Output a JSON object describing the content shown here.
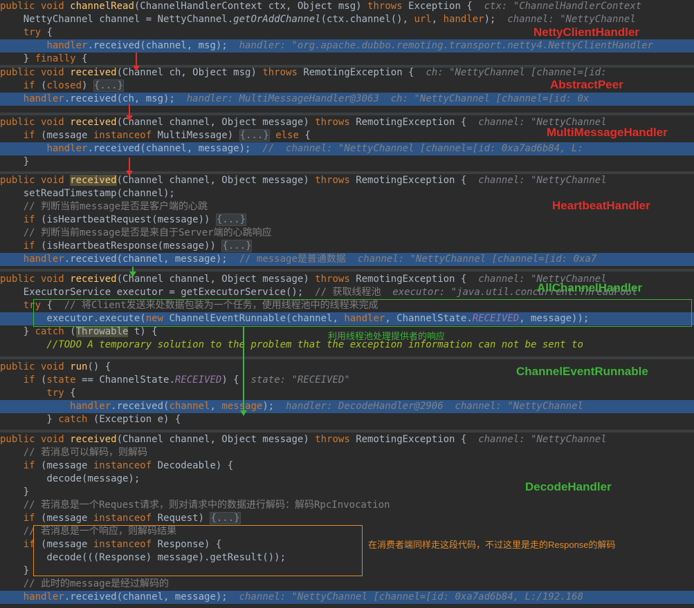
{
  "labels": {
    "netty": "NettyClientHandler",
    "abstract_peer": "AbstractPeer",
    "multi": "MultiMessageHandler",
    "heartbeat": "HeartbeatHandler",
    "all_channel": "AllChannelHandler",
    "runnable": "ChannelEventRunnable",
    "decode": "DecodeHandler"
  },
  "notes": {
    "thread_pool": "利用线程池处理提供者的响应",
    "consumer": "在消费者端同样走这段代码，不过这里是走的Response的解码"
  },
  "colors": {
    "background": "#2b2b2b",
    "highlight": "#2d5485",
    "keyword": "#cc7832",
    "method": "#ffc66d",
    "red_label": "#e0302b",
    "green_label": "#3fb33a",
    "orange_box": "#e08a2b"
  },
  "code": {
    "netty": [
      {
        "hl": false,
        "segs": [
          [
            "kw",
            "public void "
          ],
          [
            "fn",
            "channelRead"
          ],
          [
            "",
            "(ChannelHandlerContext ctx, Object msg) "
          ],
          [
            "kw",
            "throws "
          ],
          [
            "",
            "Exception {  "
          ],
          [
            "hint",
            "ctx: \"ChannelHandlerContext"
          ]
        ]
      },
      {
        "hl": false,
        "segs": [
          [
            "",
            "    NettyChannel channel = NettyChannel."
          ],
          [
            "it",
            "getOrAddChannel"
          ],
          [
            "",
            "(ctx.channel(), "
          ],
          [
            "kw",
            "url"
          ],
          [
            "",
            ", "
          ],
          [
            "kw",
            "handler"
          ],
          [
            "",
            ");  "
          ],
          [
            "hint",
            "channel: \"NettyChannel"
          ]
        ]
      },
      {
        "hl": false,
        "segs": [
          [
            "kw",
            "    try "
          ],
          [
            "",
            "{"
          ]
        ]
      },
      {
        "hl": true,
        "segs": [
          [
            "",
            "        "
          ],
          [
            "kw",
            "handler"
          ],
          [
            "",
            ".received(channel, msg);  "
          ],
          [
            "hint",
            "handler: \"org.apache.dubbo.remoting.transport.netty4.NettyClientHandler"
          ]
        ]
      },
      {
        "hl": false,
        "segs": [
          [
            "",
            "    } "
          ],
          [
            "kw",
            "finally "
          ],
          [
            "",
            "{"
          ]
        ]
      }
    ],
    "abstract_peer": [
      {
        "hl": false,
        "segs": [
          [
            "kw",
            "public void "
          ],
          [
            "fn",
            "received"
          ],
          [
            "",
            "(Channel ch, Object msg) "
          ],
          [
            "kw",
            "throws "
          ],
          [
            "",
            "RemotingException {  "
          ],
          [
            "hint",
            "ch: \"NettyChannel [channel=[id:"
          ]
        ]
      },
      {
        "hl": false,
        "segs": [
          [
            "kw",
            "    if "
          ],
          [
            "",
            "("
          ],
          [
            "kw",
            "closed"
          ],
          [
            "",
            ") "
          ],
          [
            "fold",
            "{...}"
          ]
        ]
      },
      {
        "hl": true,
        "segs": [
          [
            "",
            "    "
          ],
          [
            "kw",
            "handler"
          ],
          [
            "",
            ".received(ch, msg);  "
          ],
          [
            "hint",
            "handler: MultiMessageHandler@3063  ch: \"NettyChannel [channel=[id: 0x"
          ]
        ]
      }
    ],
    "multi": [
      {
        "hl": false,
        "segs": [
          [
            "kw",
            "public void "
          ],
          [
            "fn",
            "received"
          ],
          [
            "",
            "(Channel channel, Object message) "
          ],
          [
            "kw",
            "throws "
          ],
          [
            "",
            "RemotingException {  "
          ],
          [
            "hint",
            "channel: \"NettyChannel"
          ]
        ]
      },
      {
        "hl": false,
        "segs": [
          [
            "kw",
            "    if "
          ],
          [
            "",
            "(message "
          ],
          [
            "kw",
            "instanceof "
          ],
          [
            "",
            "MultiMessage) "
          ],
          [
            "fold",
            "{...}"
          ],
          [
            "",
            " "
          ],
          [
            "kw",
            "else "
          ],
          [
            "",
            "{"
          ]
        ]
      },
      {
        "hl": true,
        "segs": [
          [
            "",
            "        "
          ],
          [
            "kw",
            "handler"
          ],
          [
            "",
            ".received(channel, message);  "
          ],
          [
            "hint",
            "//  channel: \"NettyChannel [channel=[id: 0xa7ad6b84, L:"
          ]
        ]
      },
      {
        "hl": false,
        "segs": [
          [
            "",
            "    }"
          ]
        ]
      }
    ],
    "heartbeat": [
      {
        "hl": false,
        "segs": [
          [
            "kw",
            "public void "
          ],
          [
            "fnm",
            "received"
          ],
          [
            "",
            "(Channel channel, Object message) "
          ],
          [
            "kw",
            "throws "
          ],
          [
            "",
            "RemotingException {  "
          ],
          [
            "hint",
            "channel: \"NettyChannel"
          ]
        ]
      },
      {
        "hl": false,
        "segs": [
          [
            "",
            "    setReadTimestamp(channel);"
          ]
        ]
      },
      {
        "hl": false,
        "segs": [
          [
            "cm",
            "    // 判断当前message是否是客户端的心跳"
          ]
        ]
      },
      {
        "hl": false,
        "segs": [
          [
            "kw",
            "    if "
          ],
          [
            "",
            "(isHeartbeatRequest(message)) "
          ],
          [
            "fold",
            "{...}"
          ]
        ]
      },
      {
        "hl": false,
        "segs": [
          [
            "cm",
            "    // 判断当前message是否是来自于Server端的心跳响应"
          ]
        ]
      },
      {
        "hl": false,
        "segs": [
          [
            "kw",
            "    if "
          ],
          [
            "",
            "(isHeartbeatResponse(message)) "
          ],
          [
            "fold",
            "{...}"
          ]
        ]
      },
      {
        "hl": true,
        "segs": [
          [
            "",
            "    "
          ],
          [
            "kw",
            "handler"
          ],
          [
            "",
            ".received(channel, message);  "
          ],
          [
            "cm",
            "// message是普通数据  "
          ],
          [
            "hint",
            "channel: \"NettyChannel [channel=[id: 0xa7"
          ]
        ]
      }
    ],
    "all_channel": [
      {
        "hl": false,
        "segs": [
          [
            "kw",
            "public void "
          ],
          [
            "fn",
            "received"
          ],
          [
            "",
            "(Channel channel, Object message) "
          ],
          [
            "kw",
            "throws "
          ],
          [
            "",
            "RemotingException {  "
          ],
          [
            "hint",
            "channel: \"NettyChannel"
          ]
        ]
      },
      {
        "hl": false,
        "segs": [
          [
            "",
            "    ExecutorService executor = getExecutorService();  "
          ],
          [
            "cm",
            "// 获取线程池  "
          ],
          [
            "hint",
            "executor: \"java.util.concurrent.ThreadPool"
          ]
        ]
      },
      {
        "hl": false,
        "segs": [
          [
            "kw",
            "    try "
          ],
          [
            "",
            "{  "
          ],
          [
            "cm",
            "// 将Client发送来处数据包装为一个任务，使用线程池中的线程来完成"
          ]
        ]
      },
      {
        "hl": true,
        "segs": [
          [
            "",
            "        executor.execute("
          ],
          [
            "kw",
            "new "
          ],
          [
            "",
            "ChannelEventRunnable(channel, "
          ],
          [
            "kw",
            "handler"
          ],
          [
            "",
            ", ChannelState."
          ],
          [
            "cn",
            "RECEIVED"
          ],
          [
            "",
            ", message));"
          ]
        ]
      },
      {
        "hl": false,
        "segs": [
          [
            "",
            "    } "
          ],
          [
            "kw",
            "catch "
          ],
          [
            "",
            "("
          ],
          [
            "mk",
            "Throwable"
          ],
          [
            "",
            " t) {"
          ]
        ]
      },
      {
        "hl": false,
        "segs": [
          [
            "todo",
            "        //TODO A temporary solution to the problem that the exception information can not be sent to"
          ]
        ]
      }
    ],
    "runnable": [
      {
        "hl": false,
        "segs": [
          [
            "kw",
            "public void "
          ],
          [
            "fn",
            "run"
          ],
          [
            "",
            "() {"
          ]
        ]
      },
      {
        "hl": false,
        "segs": [
          [
            "kw",
            "    if "
          ],
          [
            "",
            "("
          ],
          [
            "kw",
            "state "
          ],
          [
            "",
            "== ChannelState."
          ],
          [
            "cn",
            "RECEIVED"
          ],
          [
            "",
            ") {  "
          ],
          [
            "hint",
            "state: \"RECEIVED\""
          ]
        ]
      },
      {
        "hl": false,
        "segs": [
          [
            "kw",
            "        try "
          ],
          [
            "",
            "{"
          ]
        ]
      },
      {
        "hl": true,
        "segs": [
          [
            "",
            "            "
          ],
          [
            "kw",
            "handler"
          ],
          [
            "",
            ".received("
          ],
          [
            "kw",
            "channel"
          ],
          [
            "",
            ", "
          ],
          [
            "kw",
            "message"
          ],
          [
            "",
            ");  "
          ],
          [
            "hint",
            "handler: DecodeHandler@2906  channel: \"NettyChannel"
          ]
        ]
      },
      {
        "hl": false,
        "segs": [
          [
            "",
            "        } "
          ],
          [
            "kw",
            "catch "
          ],
          [
            "",
            "(Exception e) {"
          ]
        ]
      }
    ],
    "decode": [
      {
        "hl": false,
        "segs": [
          [
            "kw",
            "public void "
          ],
          [
            "fn",
            "received"
          ],
          [
            "",
            "(Channel channel, Object message) "
          ],
          [
            "kw",
            "throws "
          ],
          [
            "",
            "RemotingException {  "
          ],
          [
            "hint",
            "channel: \"NettyChannel"
          ]
        ]
      },
      {
        "hl": false,
        "segs": [
          [
            "cm",
            "    // 若消息可以解码，则解码"
          ]
        ]
      },
      {
        "hl": false,
        "segs": [
          [
            "kw",
            "    if "
          ],
          [
            "",
            "(message "
          ],
          [
            "kw",
            "instanceof "
          ],
          [
            "",
            "Decodeable) {"
          ]
        ]
      },
      {
        "hl": false,
        "segs": [
          [
            "",
            "        decode(message);"
          ]
        ]
      },
      {
        "hl": false,
        "segs": [
          [
            "",
            "    }"
          ]
        ]
      },
      {
        "hl": false,
        "segs": [
          [
            "cm",
            "    // 若消息是一个Request请求，则对请求中的数据进行解码：解码RpcInvocation"
          ]
        ]
      },
      {
        "hl": false,
        "segs": [
          [
            "kw",
            "    if "
          ],
          [
            "",
            "(message "
          ],
          [
            "kw",
            "instanceof "
          ],
          [
            "",
            "Request) "
          ],
          [
            "fold",
            "{...}"
          ]
        ]
      },
      {
        "hl": false,
        "segs": [
          [
            "cm",
            "    // 若消息是一个响应，则解码结果"
          ]
        ]
      },
      {
        "hl": false,
        "segs": [
          [
            "kw",
            "    if "
          ],
          [
            "",
            "(message "
          ],
          [
            "kw",
            "instanceof "
          ],
          [
            "",
            "Response) {"
          ]
        ]
      },
      {
        "hl": false,
        "segs": [
          [
            "",
            "        decode(((Response) message).getResult());"
          ]
        ]
      },
      {
        "hl": false,
        "segs": [
          [
            "",
            "    }"
          ]
        ]
      },
      {
        "hl": false,
        "segs": [
          [
            "cm",
            "    // 此时的message是经过解码的"
          ]
        ]
      },
      {
        "hl": true,
        "segs": [
          [
            "",
            "    "
          ],
          [
            "kw",
            "handler"
          ],
          [
            "",
            ".received(channel, message);  "
          ],
          [
            "hint",
            "channel: \"NettyChannel [channel=[id: 0xa7ad6b84, L:/192.168"
          ]
        ]
      }
    ]
  }
}
